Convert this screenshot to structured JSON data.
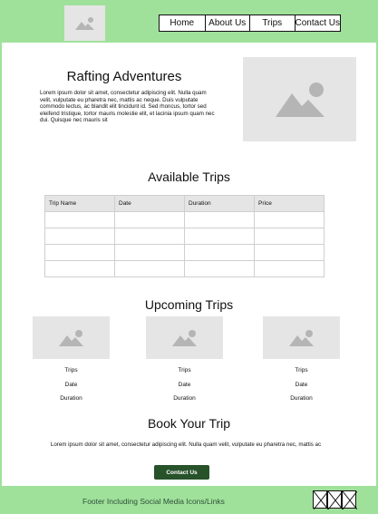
{
  "nav": {
    "items": [
      {
        "label": "Home"
      },
      {
        "label": "About Us"
      },
      {
        "label": "Trips"
      },
      {
        "label": "Contact Us"
      }
    ]
  },
  "hero": {
    "title": "Rafting Adventures",
    "body": "Lorem ipsum dolor sit amet, consectetur adipiscing elit. Nulla quam velit, vulputate eu pharetra nec, mattis ac neque. Duis vulputate commodo lectus, ac blandit elit tincidunt id. Sed rhoncus, tortor sed eleifend tristique, tortor mauris molestie elit, et lacinia ipsum quam nec dui. Quisque nec mauris sit",
    "image_icon": "image-placeholder-icon"
  },
  "available_trips": {
    "title": "Available Trips",
    "columns": [
      "Trip Name",
      "Date",
      "Duration",
      "Price"
    ],
    "rows": [
      [
        "",
        "",
        "",
        ""
      ],
      [
        "",
        "",
        "",
        ""
      ],
      [
        "",
        "",
        "",
        ""
      ],
      [
        "",
        "",
        "",
        ""
      ]
    ]
  },
  "upcoming_trips": {
    "title": "Upcoming Trips",
    "cards": [
      {
        "line1": "Trips",
        "line2": "Date",
        "line3": "Duration"
      },
      {
        "line1": "Trips",
        "line2": "Date",
        "line3": "Duration"
      },
      {
        "line1": "Trips",
        "line2": "Date",
        "line3": "Duration"
      }
    ]
  },
  "book": {
    "title": "Book Your Trip",
    "body": "Lorem ipsum dolor sit amet, consectetur adipiscing elit. Nulla quam velit, vulputate eu pharetra nec, mattis ac",
    "button_label": "Contact Us"
  },
  "footer": {
    "text": "Footer Including Social Media Icons/Links",
    "social_icons": [
      "social-icon-1",
      "social-icon-2",
      "social-icon-3"
    ]
  },
  "colors": {
    "header_footer_green": "#9fe19a",
    "button_green": "#27522a",
    "placeholder_gray": "#e5e5e5",
    "placeholder_icon_gray": "#b5b5b5"
  }
}
